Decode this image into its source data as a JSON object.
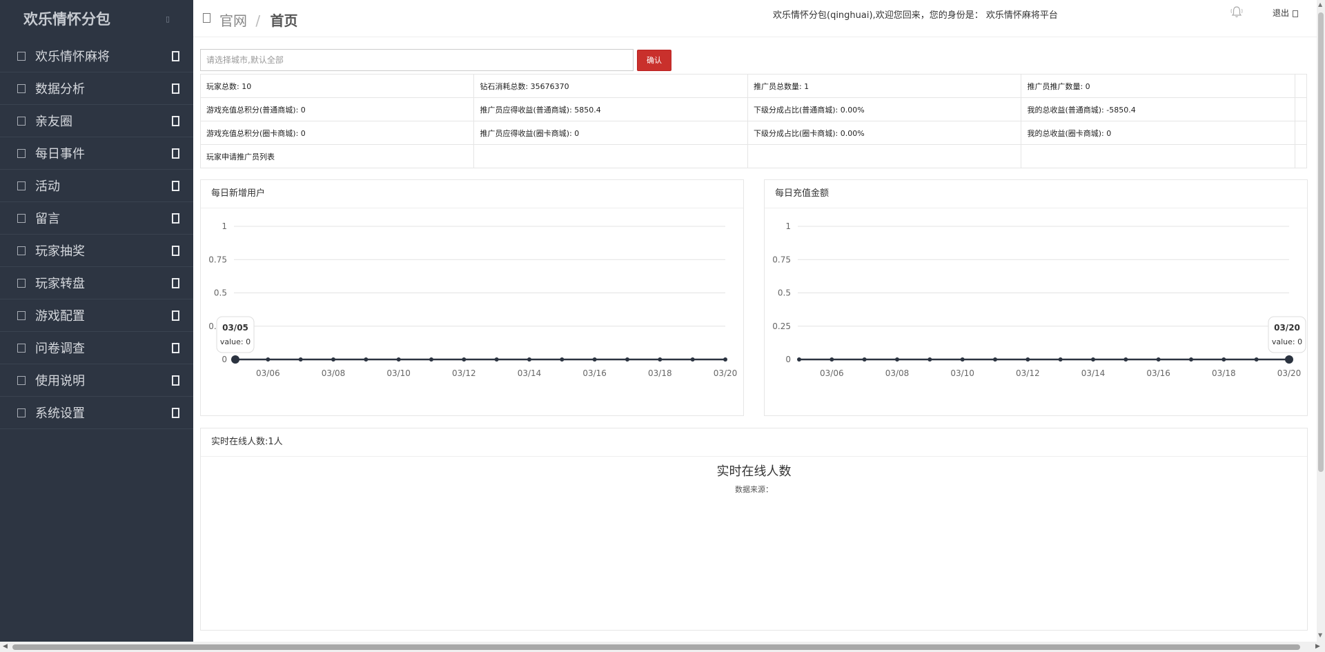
{
  "brand": {
    "title": "欢乐情怀分包"
  },
  "sidebar": {
    "items": [
      {
        "label": "欢乐情怀麻将"
      },
      {
        "label": "数据分析"
      },
      {
        "label": "亲友圈"
      },
      {
        "label": "每日事件"
      },
      {
        "label": "活动"
      },
      {
        "label": "留言"
      },
      {
        "label": "玩家抽奖"
      },
      {
        "label": "玩家转盘"
      },
      {
        "label": "游戏配置"
      },
      {
        "label": "问卷调查"
      },
      {
        "label": "使用说明"
      },
      {
        "label": "系统设置"
      }
    ]
  },
  "header": {
    "breadcrumb_root": "官网",
    "breadcrumb_sep": "/",
    "breadcrumb_current": "首页",
    "welcome": "欢乐情怀分包(qinghuai),欢迎您回来，您的身份是： 欢乐情怀麻将平台",
    "logout": "退出"
  },
  "filter": {
    "city_placeholder": "请选择城市,默认全部",
    "confirm": "确认"
  },
  "stats": {
    "rows": [
      [
        "玩家总数: 10",
        "钻石消耗总数: 35676370",
        "推广员总数量: 1",
        "推广员推广数量: 0"
      ],
      [
        "游戏充值总积分(普通商城): 0",
        "推广员应得收益(普通商城): 5850.4",
        "下级分成占比(普通商城): 0.00%",
        "我的总收益(普通商城): -5850.4"
      ],
      [
        "游戏充值总积分(圈卡商城): 0",
        "推广员应得收益(圈卡商城): 0",
        "下级分成占比(圈卡商城): 0.00%",
        "我的总收益(圈卡商城): 0"
      ],
      [
        "玩家申请推广员列表",
        "",
        "",
        ""
      ]
    ]
  },
  "chart_data": [
    {
      "type": "line",
      "title": "每日新增用户",
      "x": [
        "03/05",
        "03/06",
        "03/07",
        "03/08",
        "03/09",
        "03/10",
        "03/11",
        "03/12",
        "03/13",
        "03/14",
        "03/15",
        "03/16",
        "03/17",
        "03/18",
        "03/19",
        "03/20"
      ],
      "x_tick_labels": [
        "03/06",
        "03/08",
        "03/10",
        "03/12",
        "03/14",
        "03/16",
        "03/18",
        "03/20"
      ],
      "values": [
        0,
        0,
        0,
        0,
        0,
        0,
        0,
        0,
        0,
        0,
        0,
        0,
        0,
        0,
        0,
        0
      ],
      "y_ticks": [
        "0",
        "0.25",
        "0.5",
        "0.75",
        "1"
      ],
      "ylim": [
        0,
        1
      ],
      "grid": true,
      "tooltip": {
        "x": "03/05",
        "label": "value: 0"
      }
    },
    {
      "type": "line",
      "title": "每日充值金额",
      "x": [
        "03/05",
        "03/06",
        "03/07",
        "03/08",
        "03/09",
        "03/10",
        "03/11",
        "03/12",
        "03/13",
        "03/14",
        "03/15",
        "03/16",
        "03/17",
        "03/18",
        "03/19",
        "03/20"
      ],
      "x_tick_labels": [
        "03/06",
        "03/08",
        "03/10",
        "03/12",
        "03/14",
        "03/16",
        "03/18",
        "03/20"
      ],
      "values": [
        0,
        0,
        0,
        0,
        0,
        0,
        0,
        0,
        0,
        0,
        0,
        0,
        0,
        0,
        0,
        0
      ],
      "y_ticks": [
        "0",
        "0.25",
        "0.5",
        "0.75",
        "1"
      ],
      "ylim": [
        0,
        1
      ],
      "grid": true,
      "tooltip": {
        "x": "03/20",
        "label": "value: 0"
      }
    }
  ],
  "online": {
    "header": "实时在线人数:1人",
    "title": "实时在线人数",
    "source": "数据来源："
  },
  "colors": {
    "sidebar_bg": "#2d3542",
    "accent_red": "#c9302c",
    "chart_line": "#2b3340"
  },
  "icons": {
    "home": "home-icon",
    "bell": "bell-icon",
    "logout": "logout-icon",
    "nav": "menu-item-icon",
    "arrow": "chevron-icon"
  }
}
